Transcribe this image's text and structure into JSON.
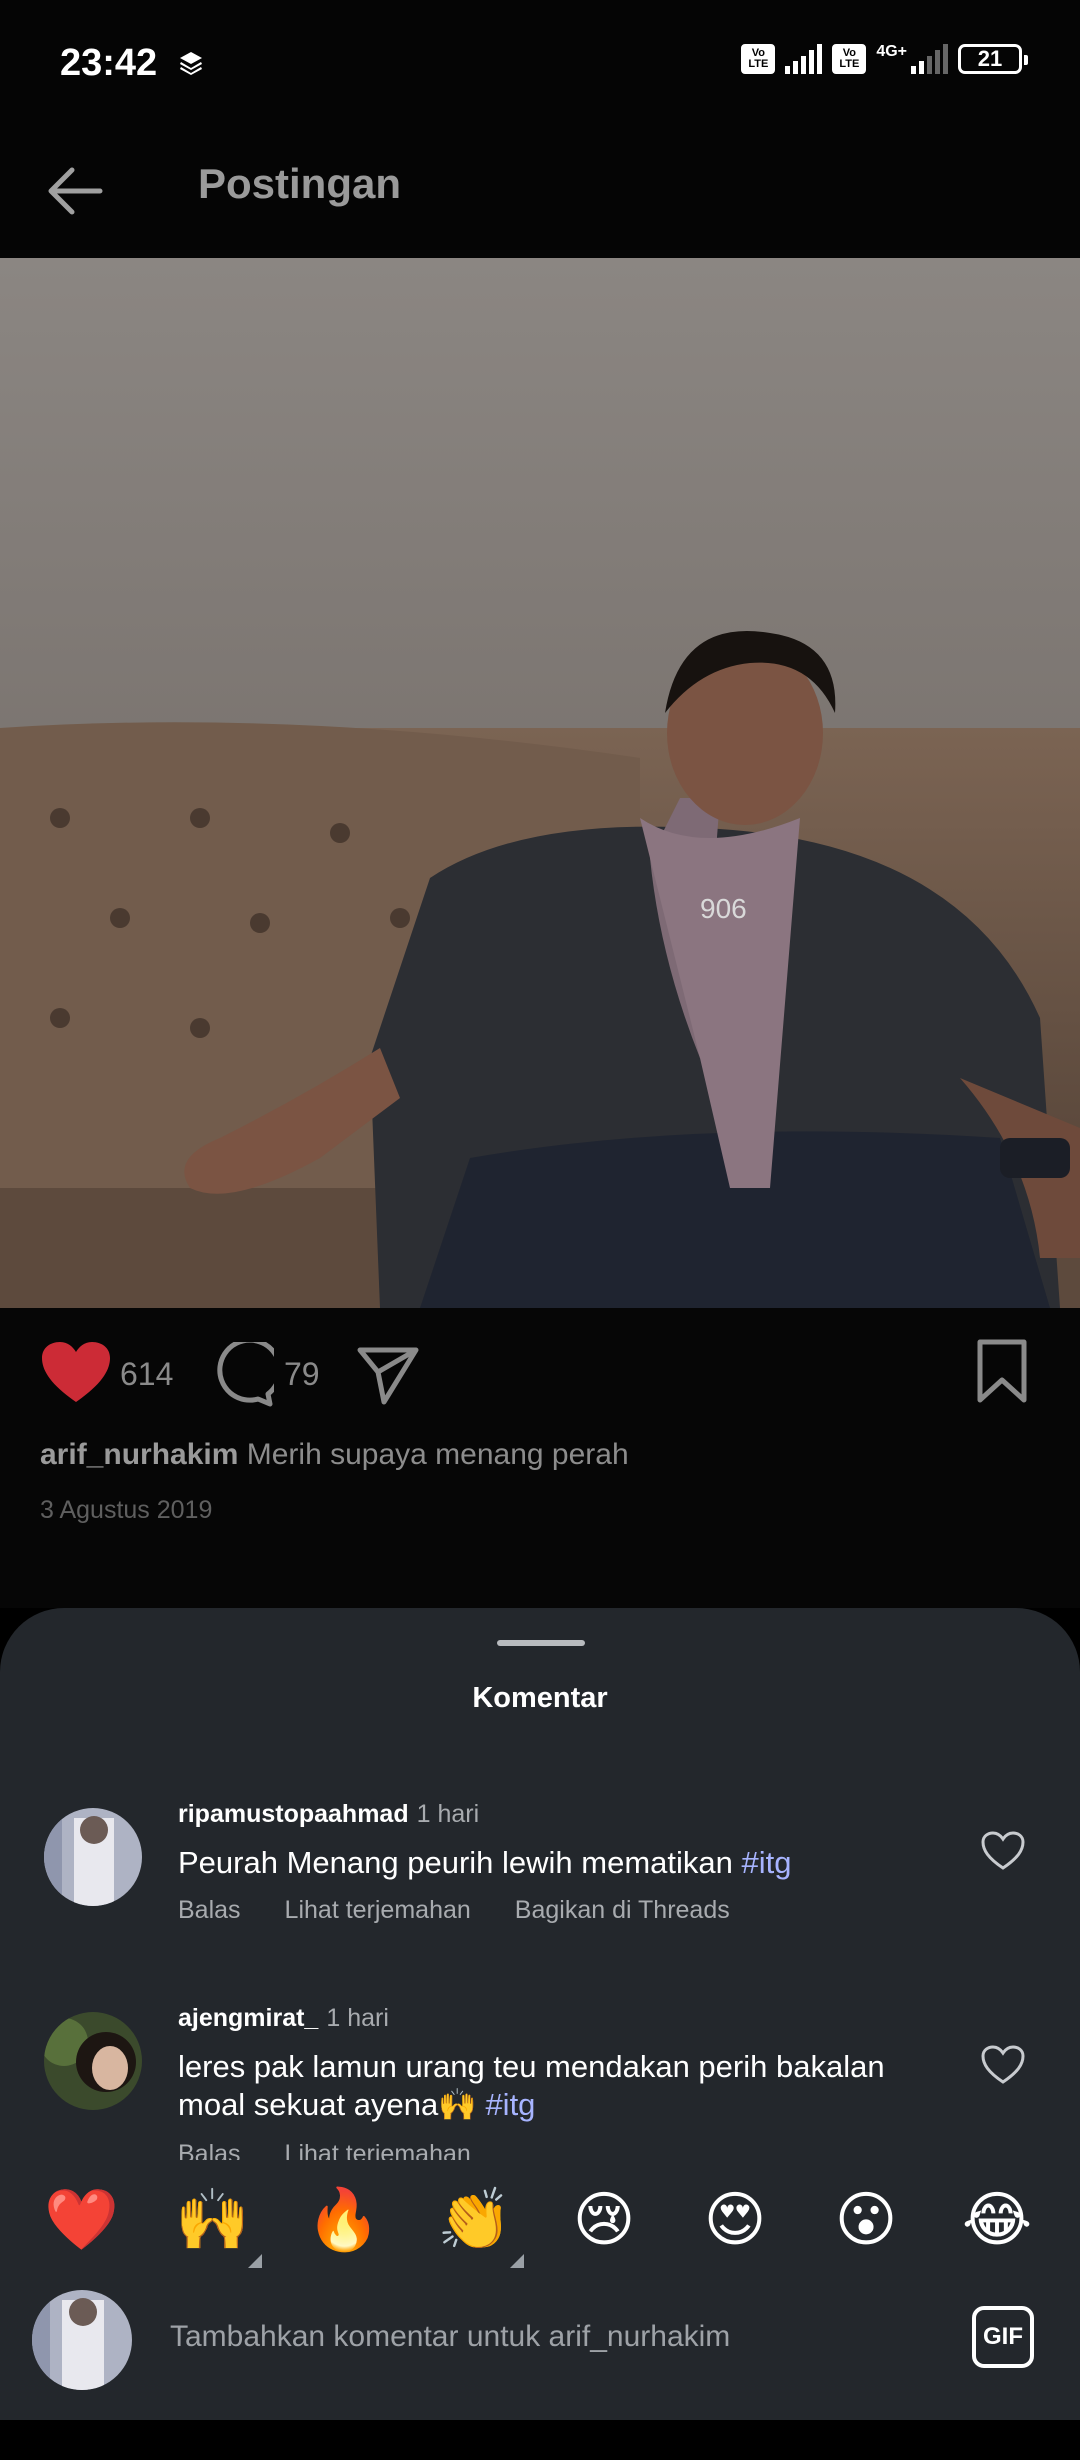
{
  "status_bar": {
    "time": "23:42",
    "volte_1": "Vo LTE",
    "volte_2": "Vo LTE",
    "network": "4G+",
    "battery": "21"
  },
  "header": {
    "title": "Postingan",
    "back_icon": "arrow-left-icon"
  },
  "post": {
    "likes": "614",
    "comments": "79",
    "username": "arif_nurhakim",
    "caption": "Merih supaya menang perah",
    "date": "3 Agustus 2019",
    "liked": true
  },
  "sheet": {
    "title": "Komentar",
    "comments": [
      {
        "user": "ripamustopaahmad",
        "time": "1 hari",
        "text": "Peurah Menang peurih lewih mematikan ",
        "hashtag": "#itg",
        "actions": [
          "Balas",
          "Lihat terjemahan",
          "Bagikan di Threads"
        ]
      },
      {
        "user": "ajengmirat_",
        "time": "1 hari",
        "text_line1": "leres pak lamun urang teu mendakan perih bakalan",
        "text_line2": "moal sekuat ayena🙌  ",
        "hashtag": "#itg",
        "actions": [
          "Balas",
          "Lihat terjemahan"
        ]
      }
    ]
  },
  "emoji_bar": [
    "❤️",
    "🙌",
    "🔥",
    "👏",
    "😢",
    "😍",
    "😮",
    "😂"
  ],
  "comment_input": {
    "placeholder": "Tambahkan komentar untuk arif_nurhakim",
    "gif_label": "GIF"
  },
  "colors": {
    "background": "#050505",
    "sheet": "#23272c",
    "like_red": "#cc2b36",
    "hashtag": "#a7b4ff"
  }
}
